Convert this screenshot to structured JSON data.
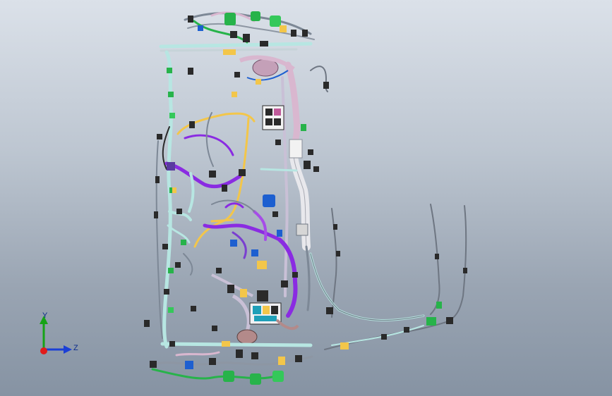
{
  "viewport": {
    "background_top": "#dbe1e9",
    "background_bottom": "#8693a3"
  },
  "model": {
    "description_icon": "wire-harness-assembly-icon",
    "colors": {
      "frame": "#b7e6e2",
      "purple_bundle": "#8a2be2",
      "yellow_bundle": "#f3c64a",
      "pink_bundle": "#d9b7cf",
      "green_connector": "#27b34a",
      "blue_clip": "#1d5fd0",
      "dark_connector": "#2a2a2a",
      "gray_wire": "#6e7682"
    }
  },
  "triad": {
    "y_label": "Y",
    "z_label": "Z",
    "y_color": "#16a316",
    "z_color": "#1b3fd6",
    "origin_color": "#e01b1b"
  }
}
